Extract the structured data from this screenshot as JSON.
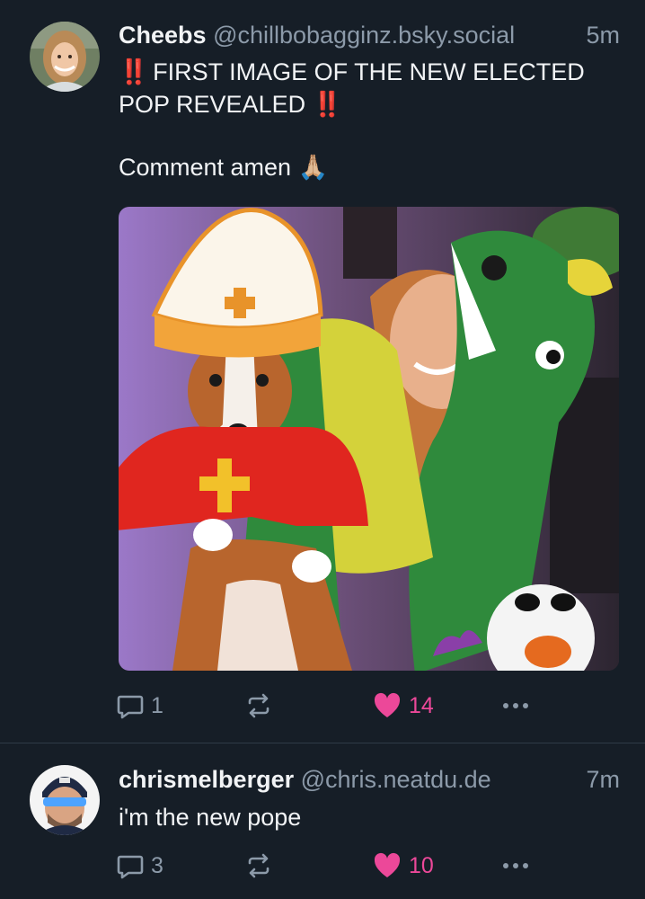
{
  "post1": {
    "display_name": "Cheebs",
    "handle": "@chillbobagginz.bsky.social",
    "time": "5m",
    "line1_prefix": "‼️",
    "line1": "FIRST IMAGE OF THE NEW ELECTED",
    "line2": "POP REVEALED",
    "line2_suffix": "‼️",
    "line3": "Comment amen",
    "line3_emoji": "🙏🏼",
    "replies": "1",
    "likes": "14"
  },
  "post2": {
    "display_name": "chrismelberger",
    "handle": "@chris.neatdu.de",
    "time": "7m",
    "text": "i'm the new pope",
    "replies": "3",
    "likes": "10"
  },
  "colors": {
    "background": "#161e27",
    "muted": "#8c9aa9",
    "like": "#ec4899",
    "divider": "#2e3a47"
  },
  "icons": [
    "reply-icon",
    "repost-icon",
    "heart-icon",
    "more-icon"
  ]
}
